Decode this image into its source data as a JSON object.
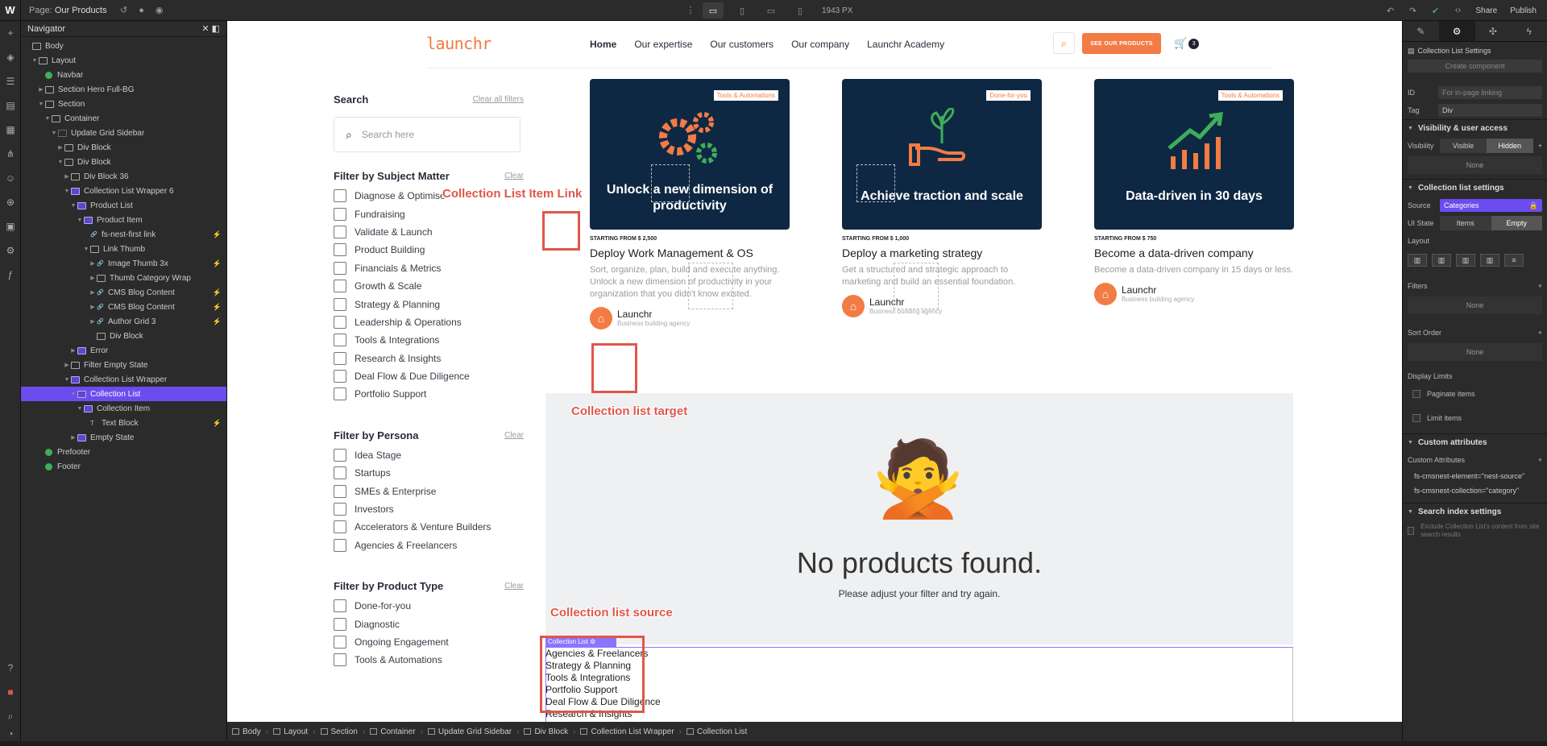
{
  "topbar": {
    "logo": "W",
    "page_prefix": "Page:",
    "page_name": "Our Products",
    "canvas_width": "1943 PX",
    "share": "Share",
    "publish": "Publish"
  },
  "navigator": {
    "title": "Navigator",
    "items": [
      {
        "label": "Body",
        "depth": 0,
        "icon": "box"
      },
      {
        "label": "Layout",
        "depth": 1,
        "icon": "box",
        "caret": "down"
      },
      {
        "label": "Navbar",
        "depth": 2,
        "icon": "component"
      },
      {
        "label": "Section Hero Full-BG",
        "depth": 2,
        "icon": "box",
        "caret": "right"
      },
      {
        "label": "Section",
        "depth": 2,
        "icon": "box",
        "caret": "down"
      },
      {
        "label": "Container",
        "depth": 3,
        "icon": "box",
        "caret": "down"
      },
      {
        "label": "Update Grid Sidebar",
        "depth": 4,
        "icon": "grid",
        "caret": "down"
      },
      {
        "label": "Div Block",
        "depth": 5,
        "icon": "box",
        "caret": "right"
      },
      {
        "label": "Div Block",
        "depth": 5,
        "icon": "box",
        "caret": "down"
      },
      {
        "label": "Div Block 36",
        "depth": 6,
        "icon": "box",
        "caret": "right"
      },
      {
        "label": "Collection List Wrapper 6",
        "depth": 6,
        "icon": "cms",
        "caret": "down"
      },
      {
        "label": "Product List",
        "depth": 7,
        "icon": "cms",
        "caret": "down"
      },
      {
        "label": "Product Item",
        "depth": 8,
        "icon": "cms",
        "caret": "down"
      },
      {
        "label": "fs-nest-first link",
        "depth": 9,
        "icon": "link",
        "flag": "attr"
      },
      {
        "label": "Link Thumb",
        "depth": 9,
        "icon": "box",
        "caret": "down"
      },
      {
        "label": "Image Thumb 3x",
        "depth": 10,
        "icon": "link",
        "caret": "right",
        "flag": "attr"
      },
      {
        "label": "Thumb Category Wrap",
        "depth": 10,
        "icon": "box",
        "caret": "right"
      },
      {
        "label": "CMS Blog Content",
        "depth": 10,
        "icon": "link",
        "caret": "right",
        "flag": "attr"
      },
      {
        "label": "CMS Blog Content",
        "depth": 10,
        "icon": "link",
        "caret": "right",
        "flag": "attr"
      },
      {
        "label": "Author Grid 3",
        "depth": 10,
        "icon": "link",
        "caret": "right",
        "flag": "attr"
      },
      {
        "label": "Div Block",
        "depth": 10,
        "icon": "box"
      },
      {
        "label": "Error",
        "depth": 7,
        "icon": "cms",
        "caret": "right"
      },
      {
        "label": "Filter Empty State",
        "depth": 6,
        "icon": "box",
        "caret": "right"
      },
      {
        "label": "Collection List Wrapper",
        "depth": 6,
        "icon": "cms",
        "caret": "down"
      },
      {
        "label": "Collection List",
        "depth": 7,
        "icon": "cms",
        "caret": "down",
        "selected": true
      },
      {
        "label": "Collection Item",
        "depth": 8,
        "icon": "cms",
        "caret": "down"
      },
      {
        "label": "Text Block",
        "depth": 9,
        "icon": "text",
        "flag": "attr"
      },
      {
        "label": "Empty State",
        "depth": 7,
        "icon": "cms",
        "caret": "right"
      },
      {
        "label": "Prefooter",
        "depth": 2,
        "icon": "component"
      },
      {
        "label": "Footer",
        "depth": 2,
        "icon": "component"
      }
    ]
  },
  "site": {
    "logo": "launchr",
    "menu": [
      "Home",
      "Our expertise",
      "Our customers",
      "Our company",
      "Launchr Academy"
    ],
    "cta": "SEE OUR PRODUCTS",
    "cart_count": "3"
  },
  "sidebar": {
    "search_title": "Search",
    "clear_all": "Clear all filters",
    "search_placeholder": "Search here",
    "clear": "Clear",
    "groups": [
      {
        "title": "Filter by Subject Matter",
        "options": [
          "Diagnose & Optimise",
          "Fundraising",
          "Validate & Launch",
          "Product Building",
          "Financials & Metrics",
          "Growth & Scale",
          "Strategy & Planning",
          "Leadership & Operations",
          "Tools & Integrations",
          "Research & Insights",
          "Deal Flow & Due Diligence",
          "Portfolio Support"
        ]
      },
      {
        "title": "Filter by Persona",
        "options": [
          "Idea Stage",
          "Startups",
          "SMEs & Enterprise",
          "Investors",
          "Accelerators & Venture Builders",
          "Agencies & Freelancers"
        ]
      },
      {
        "title": "Filter by Product Type",
        "options": [
          "Done-for-you",
          "Diagnostic",
          "Ongoing Engagement",
          "Tools & Automations"
        ]
      }
    ]
  },
  "cards": [
    {
      "tag": "Tools & Automations",
      "heading": "Unlock a new dimension of productivity",
      "price": "STARTING FROM $ 2,500",
      "title": "Deploy Work Management & OS",
      "desc": "Sort, organize, plan, build and execute anything. Unlock a new dimension of productivity in your organization that you didn't know existed.",
      "author": "Launchr",
      "author_sub": "Business building agency",
      "icon": "gears-icon"
    },
    {
      "tag": "Done-for-you",
      "heading": "Achieve traction and scale",
      "price": "STARTING FROM $ 1,000",
      "title": "Deploy a marketing strategy",
      "desc": "Get a structured and strategic approach to marketing and build an essential foundation.",
      "author": "Launchr",
      "author_sub": "Business building agency",
      "icon": "plant-hand-icon"
    },
    {
      "tag": "Tools & Automations",
      "heading": "Data-driven in 30 days",
      "price": "STARTING FROM $ 750",
      "title": "Become a data-driven company",
      "desc": "Become a data-driven company in 15 days or less.",
      "author": "Launchr",
      "author_sub": "Business building agency",
      "icon": "growth-chart-icon"
    }
  ],
  "empty_state": {
    "emoji": "🙅",
    "heading": "No products found.",
    "text": "Please adjust your filter and try again."
  },
  "annotations": {
    "item_link": "Collection List Item Link",
    "target": "Collection list target",
    "source": "Collection list source"
  },
  "collection_list": {
    "badge": "Collection List",
    "items": [
      "Agencies & Freelancers",
      "Strategy & Planning",
      "Tools & Integrations",
      "Portfolio Support",
      "Deal Flow & Due Diligence",
      "Research & Insights"
    ]
  },
  "breadcrumb": [
    "Body",
    "Layout",
    "Section",
    "Container",
    "Update Grid Sidebar",
    "Div Block",
    "Collection List Wrapper",
    "Collection List"
  ],
  "right_panel": {
    "header": "Collection List Settings",
    "create_component": "Create component",
    "id_label": "ID",
    "id_placeholder": "For in-page linking",
    "tag_label": "Tag",
    "tag_value": "Div",
    "visibility_section": "Visibility & user access",
    "visibility_label": "Visibility",
    "visible": "Visible",
    "hidden": "Hidden",
    "none": "None",
    "cl_settings": "Collection list settings",
    "source_label": "Source",
    "source_value": "Categories",
    "ui_state_label": "UI State",
    "items": "Items",
    "empty": "Empty",
    "layout_label": "Layout",
    "filters_label": "Filters",
    "sort_label": "Sort Order",
    "display_limits": "Display Limits",
    "paginate": "Paginate items",
    "limit": "Limit items",
    "custom_attrs": "Custom attributes",
    "custom_attrs_label": "Custom Attributes",
    "attr1": "fs-cmsnest-element=\"nest-source\"",
    "attr2": "fs-cmsnest-collection=\"category\"",
    "search_index": "Search index settings",
    "exclude": "Exclude Collection List's content from site search results"
  }
}
